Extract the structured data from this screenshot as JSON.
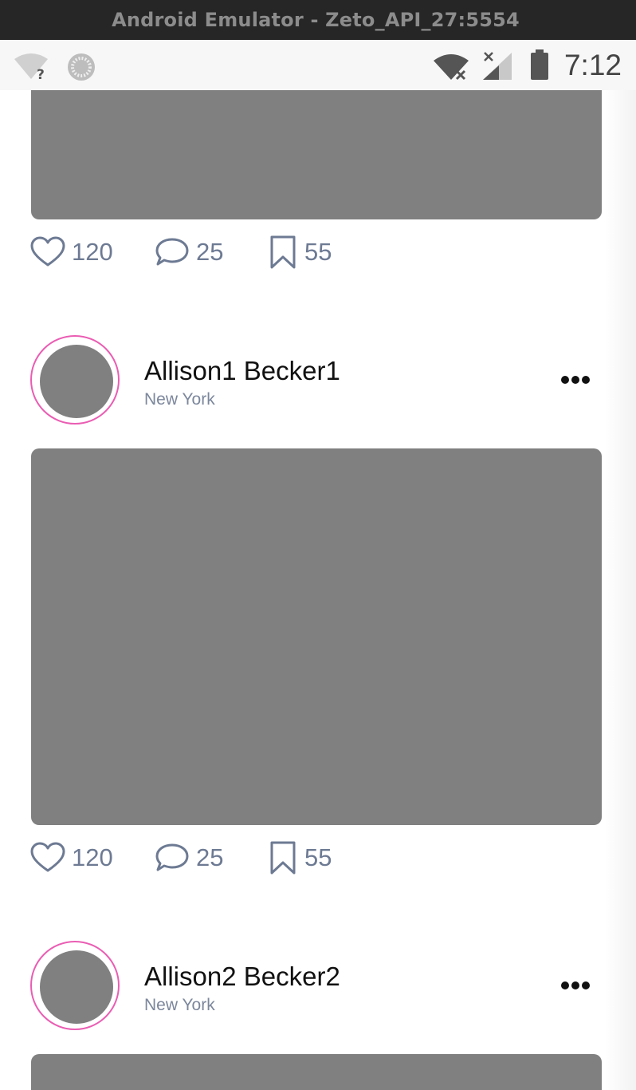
{
  "window": {
    "title": "Android Emulator - Zeto_API_27:5554"
  },
  "status_bar": {
    "time": "7:12",
    "icons": [
      "wifi-unknown-icon",
      "sync-icon",
      "wifi-off-icon",
      "signal-off-icon",
      "battery-icon"
    ]
  },
  "feed": {
    "post_0": {
      "likes": "120",
      "comments": "25",
      "saves": "55"
    },
    "post_1": {
      "author": "Allison1 Becker1",
      "location": "New York",
      "likes": "120",
      "comments": "25",
      "saves": "55"
    },
    "post_2": {
      "author": "Allison2 Becker2",
      "location": "New York"
    }
  },
  "colors": {
    "avatar_ring": "#ea5db3",
    "placeholder": "#808080",
    "action_icon": "#6d7a93",
    "location_text": "#7c879c"
  }
}
